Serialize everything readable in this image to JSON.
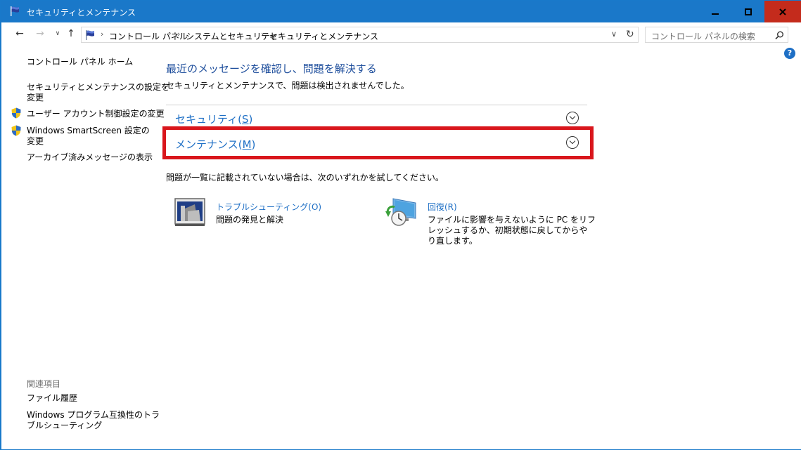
{
  "window": {
    "title": "セキュリティとメンテナンス",
    "minimize_glyph": "—",
    "maximize_glyph": "□",
    "close_glyph": "✕"
  },
  "address": {
    "back_glyph": "←",
    "forward_glyph": "→",
    "recent_glyph": "∨",
    "up_glyph": "↑",
    "crumbs": [
      "コントロール パネル",
      "システムとセキュリティ",
      "セキュリティとメンテナンス"
    ],
    "sep": "›",
    "dropdown_glyph": "∨",
    "refresh_glyph": "↻",
    "search_placeholder": "コントロール パネルの検索",
    "search_glyph": "⌕"
  },
  "help": "?",
  "sidebar": {
    "home": "コントロール パネル ホーム",
    "settings": "セキュリティとメンテナンスの設定を変更",
    "settings_l1": "セキュリティとメンテナンスの設定を",
    "settings_l2": "変更",
    "uac": "ユーザー アカウント制御設定の変更",
    "smartscreen_l1": "Windows SmartScreen 設定の",
    "smartscreen_l2": "変更",
    "archive": "アーカイブ済みメッセージの表示",
    "related_heading": "関連項目",
    "file_history": "ファイル履歴",
    "compat_l1": "Windows プログラム互換性のトラ",
    "compat_l2": "ブルシューティング"
  },
  "main": {
    "title": "最近のメッセージを確認し、問題を解決する",
    "subtitle": "セキュリティとメンテナンスで、問題は検出されませんでした。",
    "security_label": "セキュリティ(",
    "security_key": "S",
    "security_close": ")",
    "maintenance_label": "メンテナンス(",
    "maintenance_key": "M",
    "maintenance_close": ")",
    "hint": "問題が一覧に記載されていない場合は、次のいずれかを試してください。",
    "troubleshoot_link": "トラブルシューティング(O)",
    "troubleshoot_desc": "問題の発見と解決",
    "recovery_link": "回復(R)",
    "recovery_desc_l1": "ファイルに影響を与えないように PC をリフ",
    "recovery_desc_l2": "レッシュするか、初期状態に戻してからや",
    "recovery_desc_l3": "り直します。"
  },
  "colors": {
    "titlebar": "#1a78c9",
    "close_button": "#c42b1c",
    "link": "#1e6fc5",
    "heading": "#1e4e9c",
    "highlight_border": "#d9161c"
  }
}
